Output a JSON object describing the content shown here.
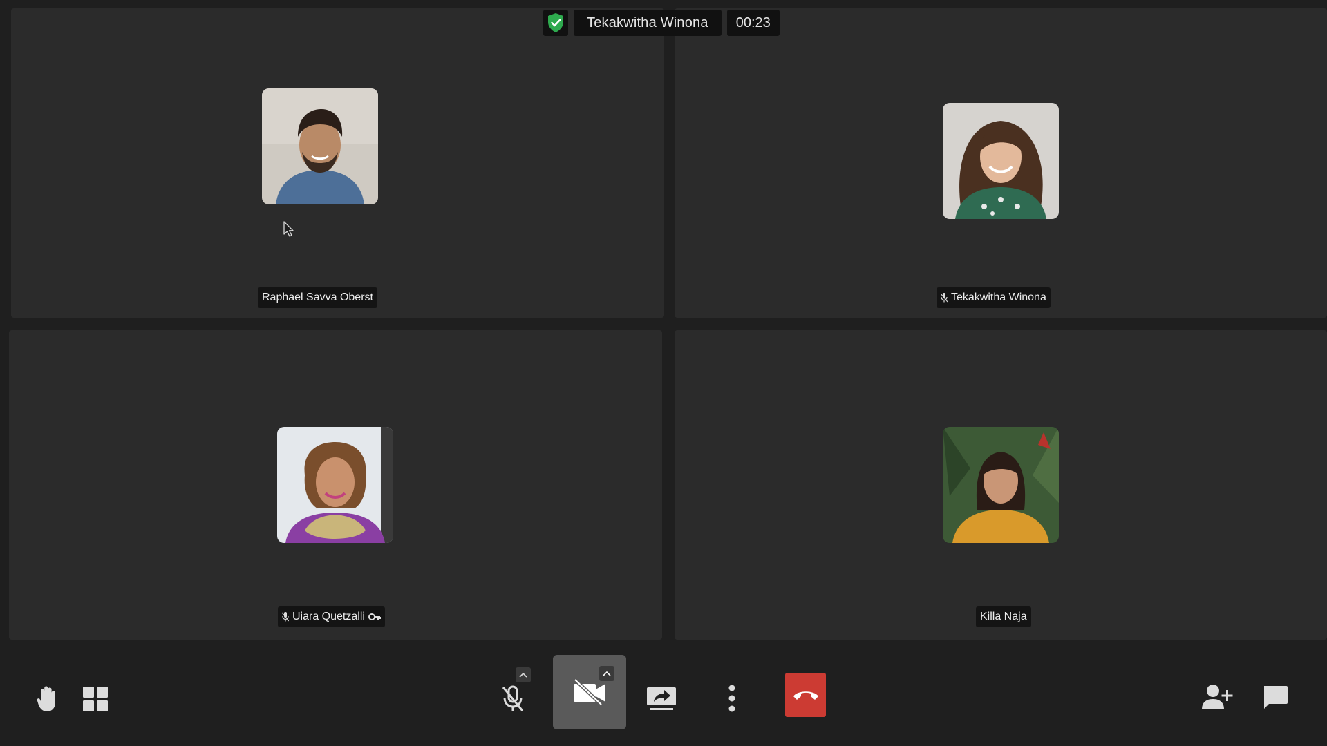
{
  "header": {
    "title": "Tekakwitha Winona",
    "timer": "00:23",
    "security_color": "#2eaa4e"
  },
  "participants": [
    {
      "name": "Raphael Savva Oberst",
      "muted": false,
      "moderator": false
    },
    {
      "name": "Tekakwitha Winona",
      "muted": true,
      "moderator": false
    },
    {
      "name": "Uiara Quetzalli",
      "muted": true,
      "moderator": true
    },
    {
      "name": "Killa Naja",
      "muted": false,
      "moderator": false
    }
  ],
  "toolbar": {
    "left": [
      "raise-hand-icon",
      "tile-view-icon"
    ],
    "center": [
      "microphone-muted-icon",
      "camera-off-icon",
      "screen-share-icon",
      "more-options-icon",
      "hangup-icon"
    ],
    "right": [
      "invite-people-icon",
      "chat-icon"
    ],
    "hangup_color": "#cc3b33"
  }
}
